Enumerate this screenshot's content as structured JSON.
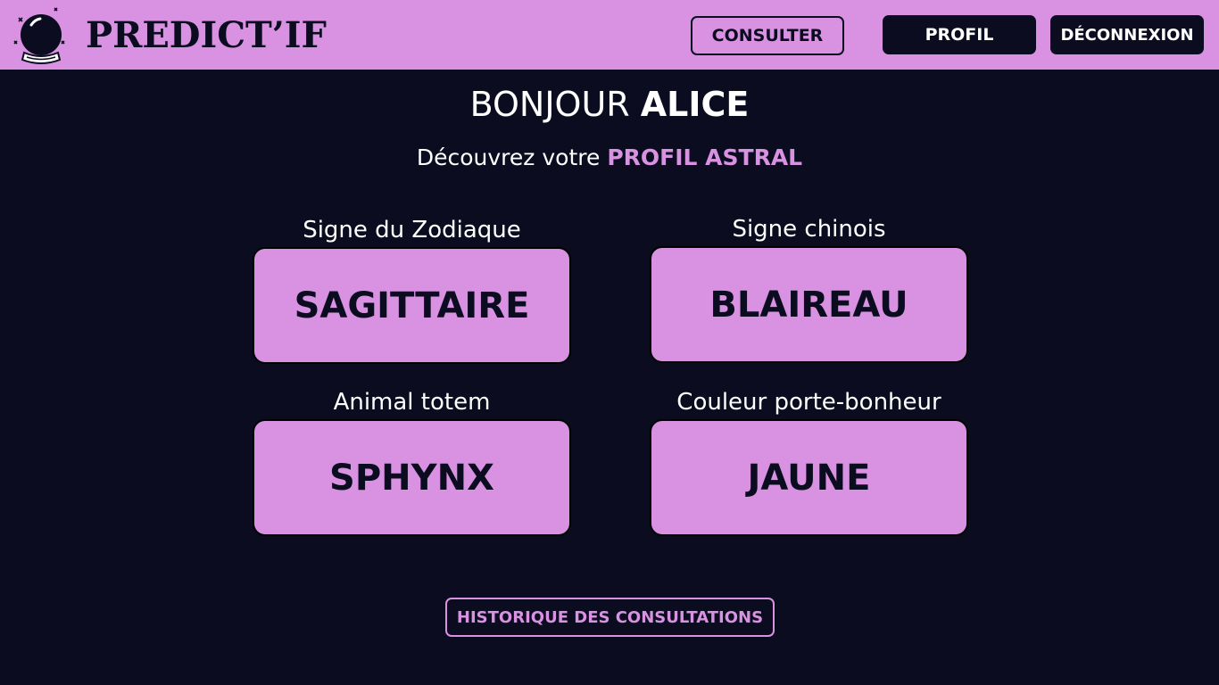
{
  "header": {
    "brand": "PREDICT’IF",
    "logo_icon": "crystal-ball-icon",
    "consult_label": "CONSULTER",
    "profile_label": "PROFIL",
    "logout_label": "DÉCONNEXION"
  },
  "greeting": {
    "prefix": "BONJOUR ",
    "name": "ALICE"
  },
  "subtitle": {
    "prefix": "Découvrez votre ",
    "accent": "PROFIL ASTRAL"
  },
  "profile": [
    {
      "label": "Signe du Zodiaque",
      "value": "SAGITTAIRE"
    },
    {
      "label": "Signe chinois",
      "value": "BLAIREAU"
    },
    {
      "label": "Animal totem",
      "value": "SPHYNX"
    },
    {
      "label": "Couleur porte-bonheur",
      "value": "JAUNE"
    }
  ],
  "history_label": "HISTORIQUE DES CONSULTATIONS",
  "colors": {
    "background": "#0b0c20",
    "accent": "#d992e2",
    "text": "#ffffff"
  }
}
